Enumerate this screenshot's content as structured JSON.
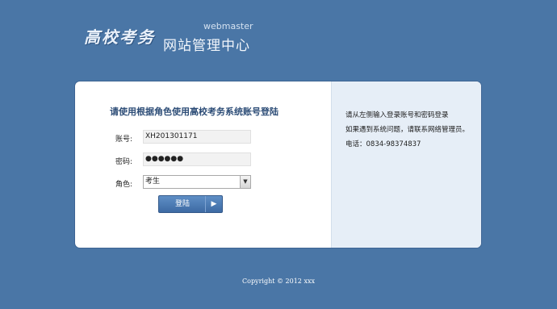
{
  "logo": {
    "calligraphy": "高校考务",
    "tagline": "webmaster",
    "subtitle": "网站管理中心"
  },
  "login_form": {
    "heading": "请使用根据角色使用高校考务系统账号登陆",
    "account_label": "账号:",
    "account_value": "XH201301171",
    "password_label": "密码:",
    "password_mask": "●●●●●●",
    "role_label": "角色:",
    "role_selected": "考生",
    "login_button": "登陆"
  },
  "info": {
    "line1": "请从左侧输入登录账号和密码登录",
    "line2": "如果遇到系统问题，请联系网络管理员。",
    "line3": "电话：0834-98374837"
  },
  "footer": {
    "copyright": "Copyright © 2012 xxx"
  }
}
